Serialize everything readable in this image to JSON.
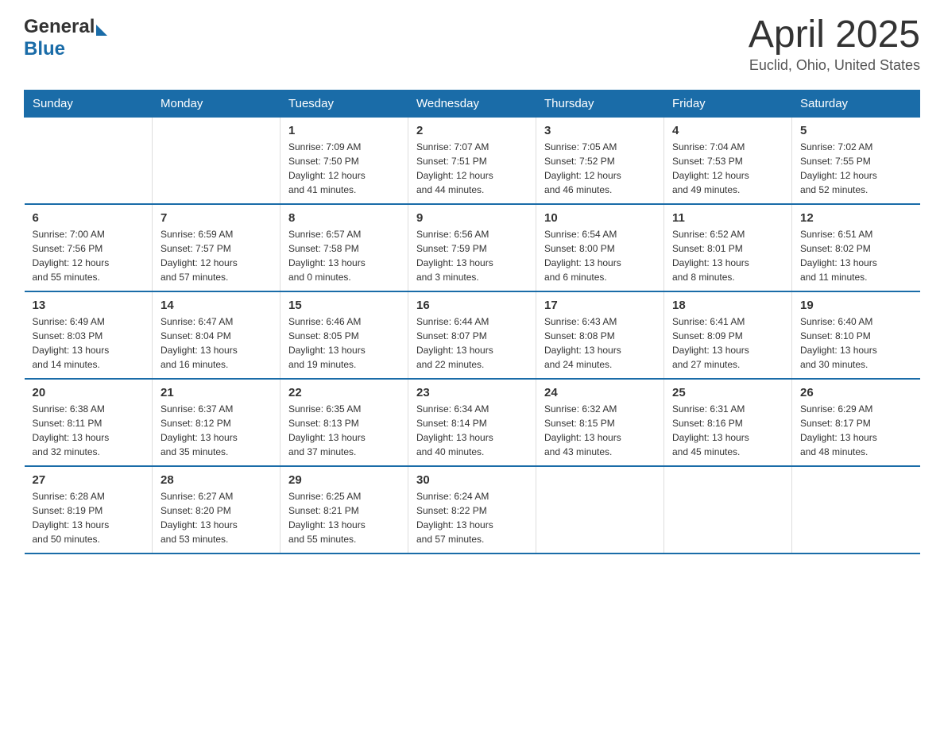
{
  "header": {
    "logo_general": "General",
    "logo_blue": "Blue",
    "month_title": "April 2025",
    "location": "Euclid, Ohio, United States"
  },
  "days_of_week": [
    "Sunday",
    "Monday",
    "Tuesday",
    "Wednesday",
    "Thursday",
    "Friday",
    "Saturday"
  ],
  "weeks": [
    [
      {
        "day": "",
        "info": ""
      },
      {
        "day": "",
        "info": ""
      },
      {
        "day": "1",
        "info": "Sunrise: 7:09 AM\nSunset: 7:50 PM\nDaylight: 12 hours\nand 41 minutes."
      },
      {
        "day": "2",
        "info": "Sunrise: 7:07 AM\nSunset: 7:51 PM\nDaylight: 12 hours\nand 44 minutes."
      },
      {
        "day": "3",
        "info": "Sunrise: 7:05 AM\nSunset: 7:52 PM\nDaylight: 12 hours\nand 46 minutes."
      },
      {
        "day": "4",
        "info": "Sunrise: 7:04 AM\nSunset: 7:53 PM\nDaylight: 12 hours\nand 49 minutes."
      },
      {
        "day": "5",
        "info": "Sunrise: 7:02 AM\nSunset: 7:55 PM\nDaylight: 12 hours\nand 52 minutes."
      }
    ],
    [
      {
        "day": "6",
        "info": "Sunrise: 7:00 AM\nSunset: 7:56 PM\nDaylight: 12 hours\nand 55 minutes."
      },
      {
        "day": "7",
        "info": "Sunrise: 6:59 AM\nSunset: 7:57 PM\nDaylight: 12 hours\nand 57 minutes."
      },
      {
        "day": "8",
        "info": "Sunrise: 6:57 AM\nSunset: 7:58 PM\nDaylight: 13 hours\nand 0 minutes."
      },
      {
        "day": "9",
        "info": "Sunrise: 6:56 AM\nSunset: 7:59 PM\nDaylight: 13 hours\nand 3 minutes."
      },
      {
        "day": "10",
        "info": "Sunrise: 6:54 AM\nSunset: 8:00 PM\nDaylight: 13 hours\nand 6 minutes."
      },
      {
        "day": "11",
        "info": "Sunrise: 6:52 AM\nSunset: 8:01 PM\nDaylight: 13 hours\nand 8 minutes."
      },
      {
        "day": "12",
        "info": "Sunrise: 6:51 AM\nSunset: 8:02 PM\nDaylight: 13 hours\nand 11 minutes."
      }
    ],
    [
      {
        "day": "13",
        "info": "Sunrise: 6:49 AM\nSunset: 8:03 PM\nDaylight: 13 hours\nand 14 minutes."
      },
      {
        "day": "14",
        "info": "Sunrise: 6:47 AM\nSunset: 8:04 PM\nDaylight: 13 hours\nand 16 minutes."
      },
      {
        "day": "15",
        "info": "Sunrise: 6:46 AM\nSunset: 8:05 PM\nDaylight: 13 hours\nand 19 minutes."
      },
      {
        "day": "16",
        "info": "Sunrise: 6:44 AM\nSunset: 8:07 PM\nDaylight: 13 hours\nand 22 minutes."
      },
      {
        "day": "17",
        "info": "Sunrise: 6:43 AM\nSunset: 8:08 PM\nDaylight: 13 hours\nand 24 minutes."
      },
      {
        "day": "18",
        "info": "Sunrise: 6:41 AM\nSunset: 8:09 PM\nDaylight: 13 hours\nand 27 minutes."
      },
      {
        "day": "19",
        "info": "Sunrise: 6:40 AM\nSunset: 8:10 PM\nDaylight: 13 hours\nand 30 minutes."
      }
    ],
    [
      {
        "day": "20",
        "info": "Sunrise: 6:38 AM\nSunset: 8:11 PM\nDaylight: 13 hours\nand 32 minutes."
      },
      {
        "day": "21",
        "info": "Sunrise: 6:37 AM\nSunset: 8:12 PM\nDaylight: 13 hours\nand 35 minutes."
      },
      {
        "day": "22",
        "info": "Sunrise: 6:35 AM\nSunset: 8:13 PM\nDaylight: 13 hours\nand 37 minutes."
      },
      {
        "day": "23",
        "info": "Sunrise: 6:34 AM\nSunset: 8:14 PM\nDaylight: 13 hours\nand 40 minutes."
      },
      {
        "day": "24",
        "info": "Sunrise: 6:32 AM\nSunset: 8:15 PM\nDaylight: 13 hours\nand 43 minutes."
      },
      {
        "day": "25",
        "info": "Sunrise: 6:31 AM\nSunset: 8:16 PM\nDaylight: 13 hours\nand 45 minutes."
      },
      {
        "day": "26",
        "info": "Sunrise: 6:29 AM\nSunset: 8:17 PM\nDaylight: 13 hours\nand 48 minutes."
      }
    ],
    [
      {
        "day": "27",
        "info": "Sunrise: 6:28 AM\nSunset: 8:19 PM\nDaylight: 13 hours\nand 50 minutes."
      },
      {
        "day": "28",
        "info": "Sunrise: 6:27 AM\nSunset: 8:20 PM\nDaylight: 13 hours\nand 53 minutes."
      },
      {
        "day": "29",
        "info": "Sunrise: 6:25 AM\nSunset: 8:21 PM\nDaylight: 13 hours\nand 55 minutes."
      },
      {
        "day": "30",
        "info": "Sunrise: 6:24 AM\nSunset: 8:22 PM\nDaylight: 13 hours\nand 57 minutes."
      },
      {
        "day": "",
        "info": ""
      },
      {
        "day": "",
        "info": ""
      },
      {
        "day": "",
        "info": ""
      }
    ]
  ]
}
